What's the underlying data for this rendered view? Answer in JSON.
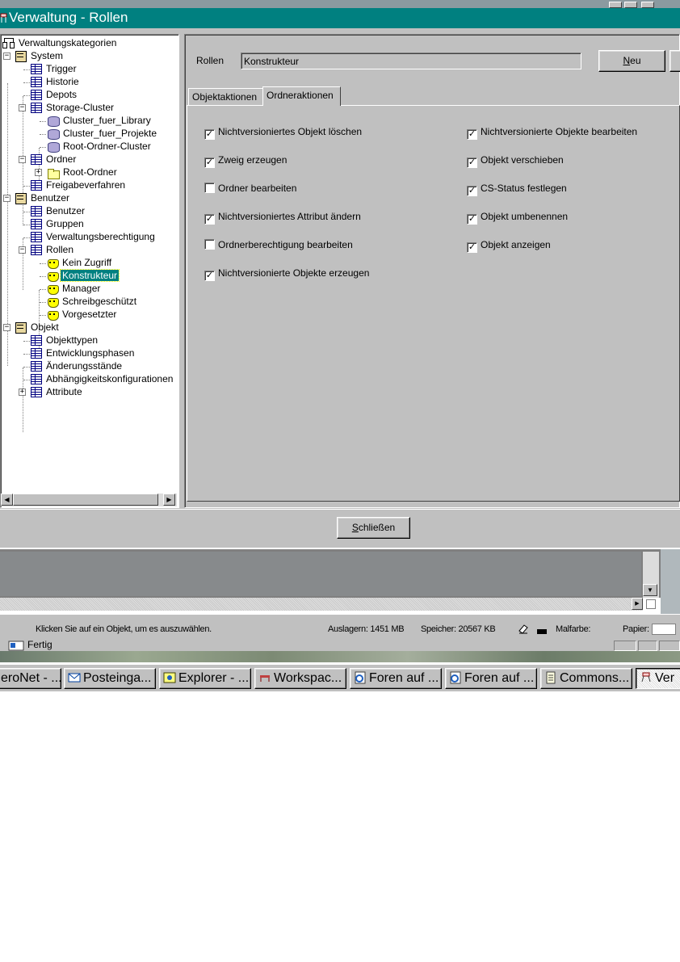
{
  "window": {
    "title": "Verwaltung - Rollen"
  },
  "tree": {
    "root_label": "Verwaltungskategorien",
    "items": [
      {
        "label": "System",
        "icon": "cabinet-icon"
      },
      {
        "label": "Trigger",
        "icon": "table-icon"
      },
      {
        "label": "Historie",
        "icon": "table-icon"
      },
      {
        "label": "Depots",
        "icon": "table-icon"
      },
      {
        "label": "Storage-Cluster",
        "icon": "table-icon"
      },
      {
        "label": "Cluster_fuer_Library",
        "icon": "database-icon"
      },
      {
        "label": "Cluster_fuer_Projekte",
        "icon": "database-icon"
      },
      {
        "label": "Root-Ordner-Cluster",
        "icon": "database-icon"
      },
      {
        "label": "Ordner",
        "icon": "table-icon"
      },
      {
        "label": "Root-Ordner",
        "icon": "folder-icon"
      },
      {
        "label": "Freigabeverfahren",
        "icon": "table-icon"
      },
      {
        "label": "Benutzer",
        "icon": "cabinet-icon"
      },
      {
        "label": "Benutzer",
        "icon": "table-icon"
      },
      {
        "label": "Gruppen",
        "icon": "table-icon"
      },
      {
        "label": "Verwaltungsberechtigung",
        "icon": "table-icon"
      },
      {
        "label": "Rollen",
        "icon": "table-icon"
      },
      {
        "label": "Kein Zugriff",
        "icon": "role-icon"
      },
      {
        "label": "Konstrukteur",
        "icon": "role-icon",
        "selected": true
      },
      {
        "label": "Manager",
        "icon": "role-icon"
      },
      {
        "label": "Schreibgeschützt",
        "icon": "role-icon"
      },
      {
        "label": "Vorgesetzter",
        "icon": "role-icon"
      },
      {
        "label": "Objekt",
        "icon": "cabinet-icon"
      },
      {
        "label": "Objekttypen",
        "icon": "table-icon"
      },
      {
        "label": "Entwicklungsphasen",
        "icon": "table-icon"
      },
      {
        "label": "Änderungsstände",
        "icon": "table-icon"
      },
      {
        "label": "Abhängigkeitskonfigurationen",
        "icon": "table-icon"
      },
      {
        "label": "Attribute",
        "icon": "table-icon"
      }
    ]
  },
  "role": {
    "label": "Rollen",
    "value": "Konstrukteur",
    "new_button_pre": "",
    "new_button_mn": "N",
    "new_button_post": "eu"
  },
  "tabs": [
    {
      "label": "Objektaktionen",
      "active": false
    },
    {
      "label": "Ordneraktionen",
      "active": true
    }
  ],
  "permissions_left": [
    {
      "label": "Nichtversioniertes Objekt löschen",
      "checked": true
    },
    {
      "label": "Zweig erzeugen",
      "checked": true
    },
    {
      "label": "Ordner bearbeiten",
      "checked": false
    },
    {
      "label": "Nichtversioniertes Attribut ändern",
      "checked": true
    },
    {
      "label": "Ordnerberechtigung bearbeiten",
      "checked": false
    },
    {
      "label": "Nichtversionierte Objekte erzeugen",
      "checked": true
    }
  ],
  "permissions_right": [
    {
      "label": "Nichtversionierte Objekte bearbeiten",
      "checked": true
    },
    {
      "label": "Objekt verschieben",
      "checked": true
    },
    {
      "label": "CS-Status festlegen",
      "checked": true
    },
    {
      "label": "Objekt umbenennen",
      "checked": true
    },
    {
      "label": "Objekt anzeigen",
      "checked": true
    }
  ],
  "close_button": {
    "mn": "S",
    "rest": "chließen"
  },
  "statusbar": {
    "hint": "Klicken Sie auf ein Objekt, um es auszuwählen.",
    "swap": "Auslagern: 1451 MB",
    "memory": "Speicher: 20567 KB",
    "color": "Malfarbe:",
    "paper": "Papier:"
  },
  "ready_text": "Fertig",
  "taskbar": [
    {
      "label": "eroNet - ...",
      "icon": "globe-icon"
    },
    {
      "label": "Posteinga...",
      "icon": "mail-icon"
    },
    {
      "label": "Explorer - ...",
      "icon": "explorer-icon"
    },
    {
      "label": "Workspac...",
      "icon": "workspace-icon"
    },
    {
      "label": "Foren auf ...",
      "icon": "ie-icon"
    },
    {
      "label": "Foren auf ...",
      "icon": "ie-icon"
    },
    {
      "label": "Commons...",
      "icon": "document-icon"
    },
    {
      "label": "Ver",
      "icon": "network-icon",
      "active": true
    }
  ]
}
